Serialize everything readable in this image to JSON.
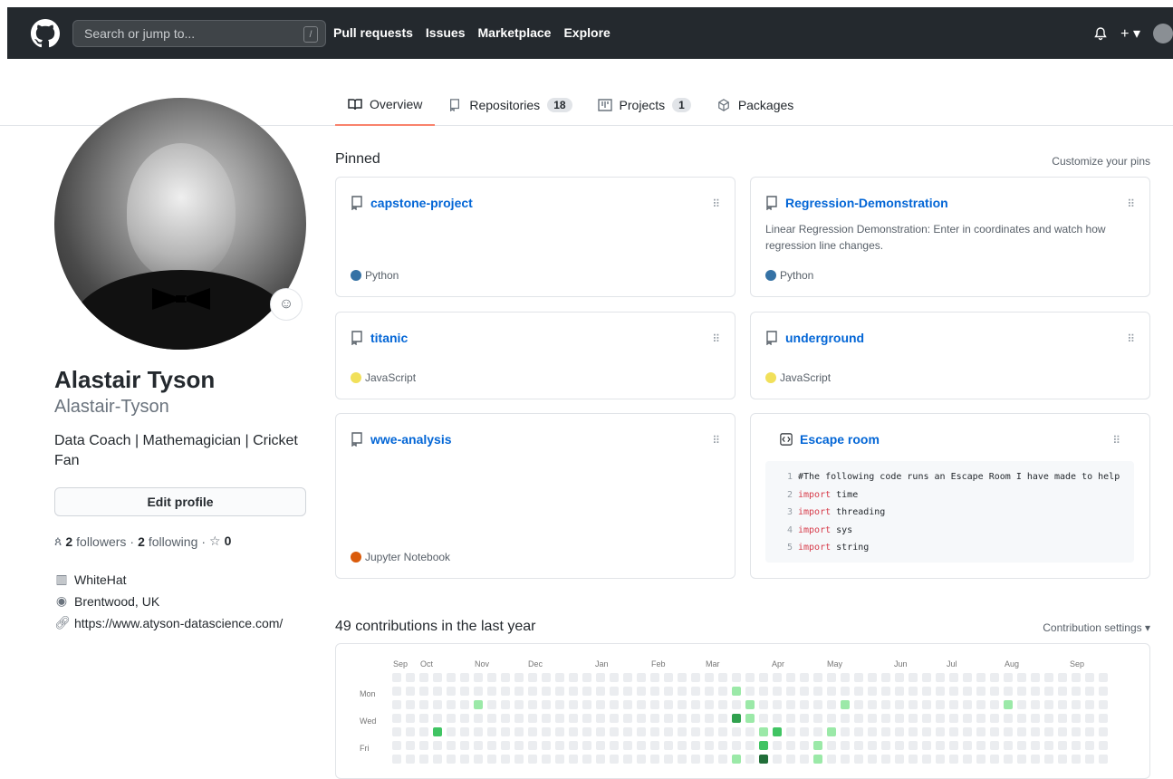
{
  "header": {
    "search_placeholder": "Search or jump to...",
    "search_shortcut": "/",
    "nav": [
      "Pull requests",
      "Issues",
      "Marketplace",
      "Explore"
    ]
  },
  "tabs": [
    {
      "label": "Overview",
      "count": null,
      "active": true,
      "icon": "book-icon"
    },
    {
      "label": "Repositories",
      "count": "18",
      "active": false,
      "icon": "repo-icon"
    },
    {
      "label": "Projects",
      "count": "1",
      "active": false,
      "icon": "project-icon"
    },
    {
      "label": "Packages",
      "count": null,
      "active": false,
      "icon": "package-icon"
    }
  ],
  "profile": {
    "name": "Alastair Tyson",
    "login": "Alastair-Tyson",
    "bio": "Data Coach | Mathemagician | Cricket Fan",
    "edit_label": "Edit profile",
    "followers": "2",
    "followers_label": "followers",
    "following": "2",
    "following_label": "following",
    "stars": "0",
    "company": "WhiteHat",
    "location": "Brentwood, UK",
    "website": "https://www.atyson-datascience.com/"
  },
  "pinned": {
    "heading": "Pinned",
    "customize": "Customize your pins",
    "cards": [
      {
        "title": "capstone-project",
        "desc": "",
        "lang": "Python",
        "lang_color": "#3572A5"
      },
      {
        "title": "Regression-Demonstration",
        "desc": "Linear Regression Demonstration: Enter in coordinates and watch how regression line changes.",
        "lang": "Python",
        "lang_color": "#3572A5"
      },
      {
        "title": "titanic",
        "desc": "",
        "lang": "JavaScript",
        "lang_color": "#f1e05a"
      },
      {
        "title": "underground",
        "desc": "",
        "lang": "JavaScript",
        "lang_color": "#f1e05a"
      },
      {
        "title": "wwe-analysis",
        "desc": "",
        "lang": "Jupyter Notebook",
        "lang_color": "#DA5B0B"
      }
    ],
    "gist": {
      "title": "Escape room",
      "lines": [
        {
          "n": "1",
          "kw": "",
          "text": "#The following code runs an Escape Room I have made to help"
        },
        {
          "n": "2",
          "kw": "import",
          "text": " time"
        },
        {
          "n": "3",
          "kw": "import",
          "text": " threading"
        },
        {
          "n": "4",
          "kw": "import",
          "text": " sys"
        },
        {
          "n": "5",
          "kw": "import",
          "text": " string"
        }
      ]
    }
  },
  "contributions": {
    "heading": "49 contributions in the last year",
    "settings": "Contribution settings ▾",
    "months": [
      "Sep",
      "Oct",
      "Nov",
      "Dec",
      "Jan",
      "Feb",
      "Mar",
      "Apr",
      "May",
      "Jun",
      "Jul",
      "Aug",
      "Sep"
    ],
    "days": [
      "Mon",
      "Wed",
      "Fri"
    ],
    "colors": [
      "#ebedf0",
      "#9be9a8",
      "#40c463",
      "#30a14e",
      "#216e39"
    ],
    "weeks": 53,
    "active_cells": [
      {
        "week": 25,
        "day": 1,
        "level": 1
      },
      {
        "week": 6,
        "day": 2,
        "level": 1
      },
      {
        "week": 26,
        "day": 2,
        "level": 1
      },
      {
        "week": 33,
        "day": 2,
        "level": 1
      },
      {
        "week": 45,
        "day": 2,
        "level": 1
      },
      {
        "week": 25,
        "day": 3,
        "level": 3
      },
      {
        "week": 26,
        "day": 3,
        "level": 1
      },
      {
        "week": 3,
        "day": 4,
        "level": 2
      },
      {
        "week": 27,
        "day": 4,
        "level": 1
      },
      {
        "week": 28,
        "day": 4,
        "level": 2
      },
      {
        "week": 32,
        "day": 4,
        "level": 1
      },
      {
        "week": 27,
        "day": 5,
        "level": 2
      },
      {
        "week": 31,
        "day": 5,
        "level": 1
      },
      {
        "week": 25,
        "day": 6,
        "level": 1
      },
      {
        "week": 27,
        "day": 6,
        "level": 4
      },
      {
        "week": 31,
        "day": 6,
        "level": 1
      }
    ]
  }
}
